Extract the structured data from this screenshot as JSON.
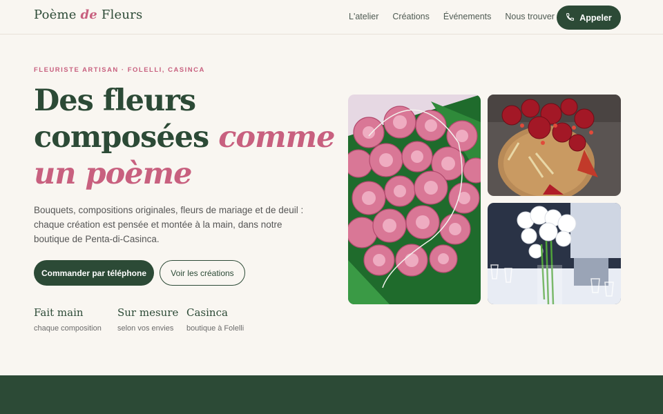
{
  "brand": {
    "part1": "Poème ",
    "part2": "de",
    "part3": " Fleurs"
  },
  "nav": [
    "L'atelier",
    "Créations",
    "Événements",
    "Nous trouver"
  ],
  "call_button": {
    "label": "Appeler",
    "icon": "phone-icon"
  },
  "hero": {
    "kicker": "FLEURISTE ARTISAN · FOLELLI, CASINCA",
    "title_line1": "Des fleurs",
    "title_line2": "composées ",
    "title_accent": "comme un poème",
    "lead": "Bouquets, compositions originales, fleurs de mariage et de deuil : chaque création est pensée et montée à la main, dans notre boutique de Penta-di-Casinca.",
    "cta_primary": "Commander par téléphone",
    "cta_secondary": "Voir les créations"
  },
  "features": [
    {
      "title": "Fait main",
      "sub": "chaque composition"
    },
    {
      "title": "Sur mesure",
      "sub": "selon vos envies"
    },
    {
      "title": "Casinca",
      "sub": "boutique à Folelli"
    }
  ],
  "colors": {
    "brand_green": "#2c4a36",
    "accent_pink": "#c8607f",
    "background": "#f9f6f1"
  }
}
